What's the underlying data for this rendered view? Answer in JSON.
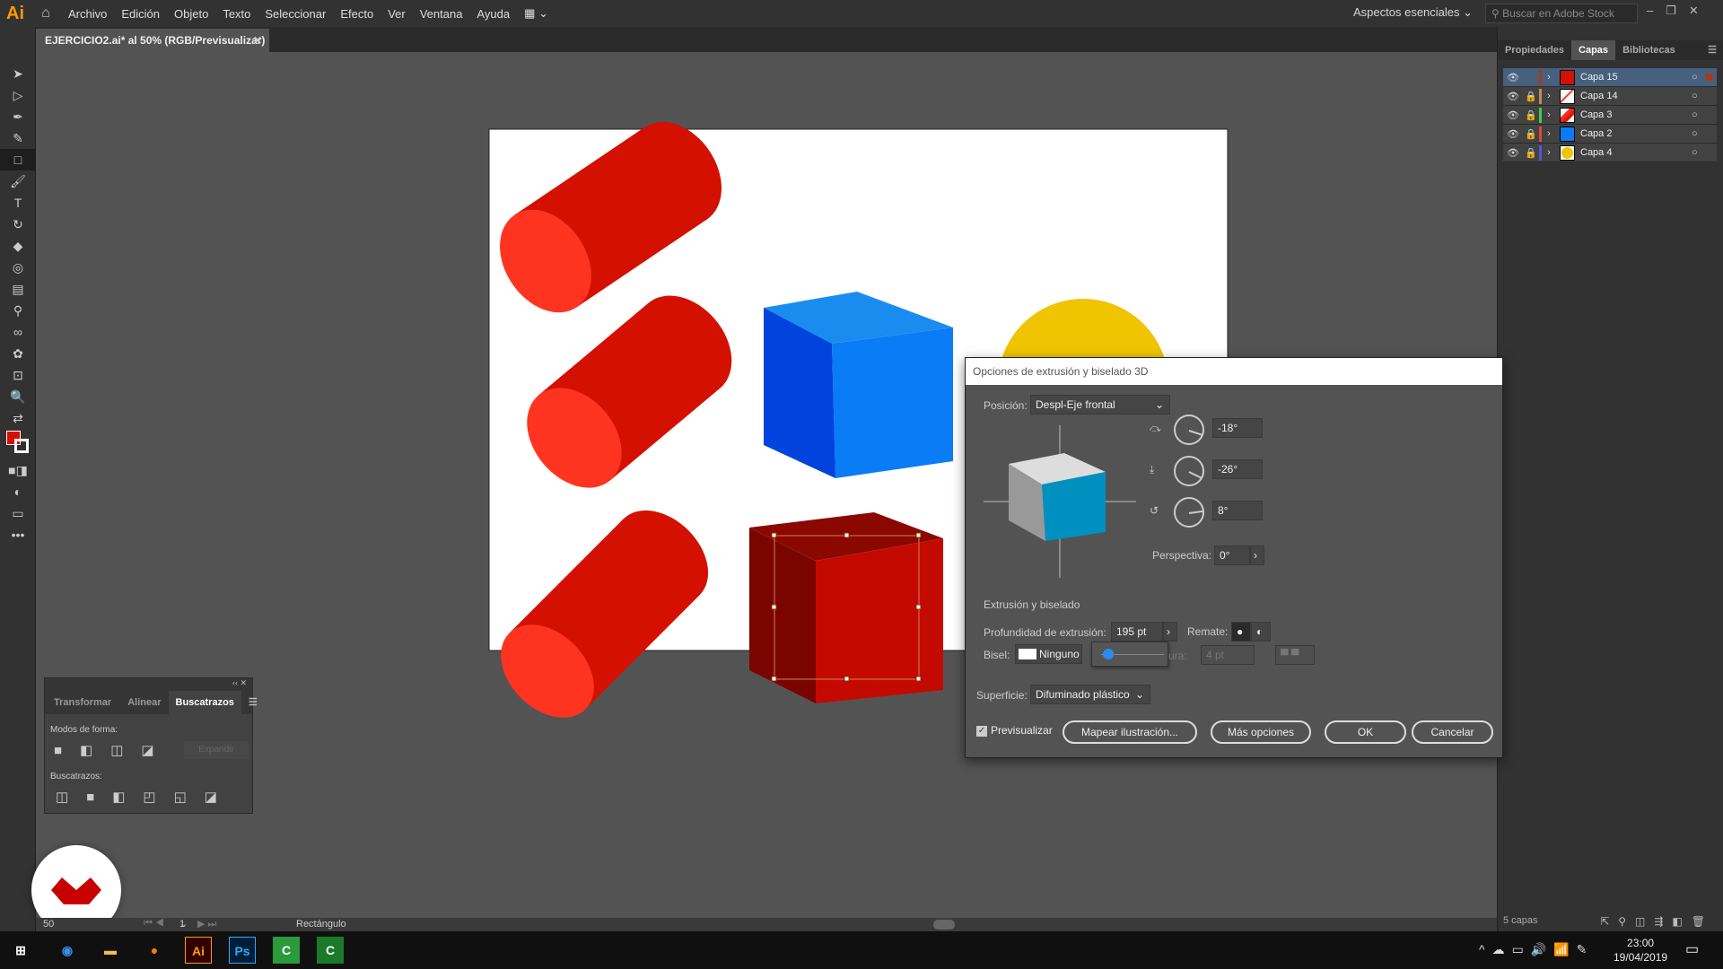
{
  "app": {
    "logo": "Ai",
    "menus": [
      "Archivo",
      "Edición",
      "Objeto",
      "Texto",
      "Seleccionar",
      "Efecto",
      "Ver",
      "Ventana",
      "Ayuda"
    ],
    "workspace": "Aspectos esenciales",
    "search_placeholder": "Buscar en Adobe Stock"
  },
  "document": {
    "tab_title": "EJERCICIO2.ai* al 50% (RGB/Previsualizar)"
  },
  "right_panel": {
    "tabs": [
      "Propiedades",
      "Capas",
      "Bibliotecas"
    ],
    "active_tab": "Capas",
    "layers": [
      {
        "name": "Capa 15",
        "color": "#a83a1a",
        "selected": true
      },
      {
        "name": "Capa 14",
        "color": "#c08a5a"
      },
      {
        "name": "Capa 3",
        "color": "#3ccf4a"
      },
      {
        "name": "Capa 2",
        "color": "#e0463a"
      },
      {
        "name": "Capa 4",
        "color": "#4a5ae0"
      }
    ],
    "layer_count": "5 capas"
  },
  "dialog": {
    "title": "Opciones de extrusión y biselado 3D",
    "position_label": "Posición:",
    "position_value": "Despl-Eje frontal",
    "rot_x": "-18°",
    "rot_y": "-26°",
    "rot_z": "8°",
    "perspective_label": "Perspectiva:",
    "perspective_value": "0°",
    "extrude_section": "Extrusión y biselado",
    "depth_label": "Profundidad de extrusión:",
    "depth_value": "195 pt",
    "cap_label": "Remate:",
    "bevel_label": "Bisel:",
    "bevel_value": "Ninguno",
    "height_label": "ura:",
    "height_value": "4 pt",
    "surface_label": "Superficie:",
    "surface_value": "Difuminado plástico",
    "preview_label": "Previsualizar",
    "preview_checked": true,
    "map_button": "Mapear ilustración...",
    "more_button": "Más opciones",
    "ok_button": "OK",
    "cancel_button": "Cancelar"
  },
  "pathfinder": {
    "tabs": [
      "Transformar",
      "Alinear",
      "Buscatrazos"
    ],
    "active_tab": "Buscatrazos",
    "shape_modes_label": "Modos de forma:",
    "expand_button": "Expandir",
    "pathfinders_label": "Buscatrazos:"
  },
  "statusbar": {
    "zoom": "50",
    "artboard": "1",
    "tool": "Rectángulo"
  },
  "taskbar": {
    "time": "23:00",
    "date": "19/04/2019"
  },
  "colors": {
    "accent": "#46607e",
    "cylinder_body": "#d41000",
    "cylinder_cap": "#ff3420",
    "cube_blue_top": "#1a8cf0",
    "cube_blue_front": "#0a7cf5",
    "cube_blue_side": "#0044dd",
    "sphere": "#f0c000",
    "cube_red": "#c40a00"
  }
}
